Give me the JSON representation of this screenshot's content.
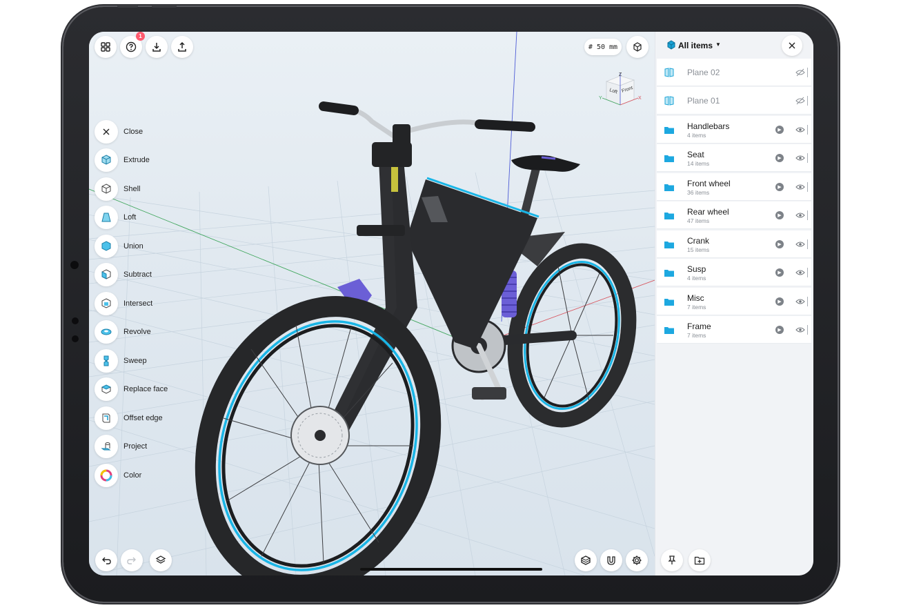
{
  "toolbar_top": {
    "help_badge": "1",
    "grid_size": "# 50 mm",
    "icons": [
      "apps-grid-icon",
      "help-icon",
      "import-icon",
      "export-icon",
      "view-mode-icon"
    ]
  },
  "viewcube": {
    "top": "Z",
    "left_face": "Loft",
    "right_face": "Front",
    "axis_y": "Y",
    "axis_x": "X"
  },
  "tools": [
    {
      "label": "Close",
      "icon": "close-icon"
    },
    {
      "label": "Extrude",
      "icon": "extrude-icon"
    },
    {
      "label": "Shell",
      "icon": "shell-icon"
    },
    {
      "label": "Loft",
      "icon": "loft-icon"
    },
    {
      "label": "Union",
      "icon": "union-icon"
    },
    {
      "label": "Subtract",
      "icon": "subtract-icon"
    },
    {
      "label": "Intersect",
      "icon": "intersect-icon"
    },
    {
      "label": "Revolve",
      "icon": "revolve-icon"
    },
    {
      "label": "Sweep",
      "icon": "sweep-icon"
    },
    {
      "label": "Replace face",
      "icon": "replace-face-icon"
    },
    {
      "label": "Offset edge",
      "icon": "offset-edge-icon"
    },
    {
      "label": "Project",
      "icon": "project-icon"
    },
    {
      "label": "Color",
      "icon": "color-icon"
    }
  ],
  "toolbar_bottom": {
    "icons": [
      "undo-icon",
      "redo-icon",
      "layers-icon",
      "materials-icon",
      "snap-magnet-icon",
      "settings-gear-icon"
    ]
  },
  "panel": {
    "title": "All items",
    "items": [
      {
        "name": "Plane 02",
        "sub": "",
        "type": "plane"
      },
      {
        "name": "Plane 01",
        "sub": "",
        "type": "plane"
      },
      {
        "name": "Handlebars",
        "sub": "4 items",
        "type": "folder"
      },
      {
        "name": "Seat",
        "sub": "14 items",
        "type": "folder"
      },
      {
        "name": "Front wheel",
        "sub": "36 items",
        "type": "folder"
      },
      {
        "name": "Rear wheel",
        "sub": "47 items",
        "type": "folder"
      },
      {
        "name": "Crank",
        "sub": "15 items",
        "type": "folder"
      },
      {
        "name": "Susp",
        "sub": "4 items",
        "type": "folder"
      },
      {
        "name": "Misc",
        "sub": "7 items",
        "type": "folder"
      },
      {
        "name": "Frame",
        "sub": "7 items",
        "type": "folder"
      }
    ],
    "footer_icons": [
      "pin-icon",
      "new-folder-icon"
    ]
  },
  "colors": {
    "accent": "#1aa3d6",
    "folder": "#1da8e0",
    "bike_frame": "#2a2b2e",
    "rim_accent": "#19b5e6",
    "shock_spring": "#6b5fd6"
  }
}
